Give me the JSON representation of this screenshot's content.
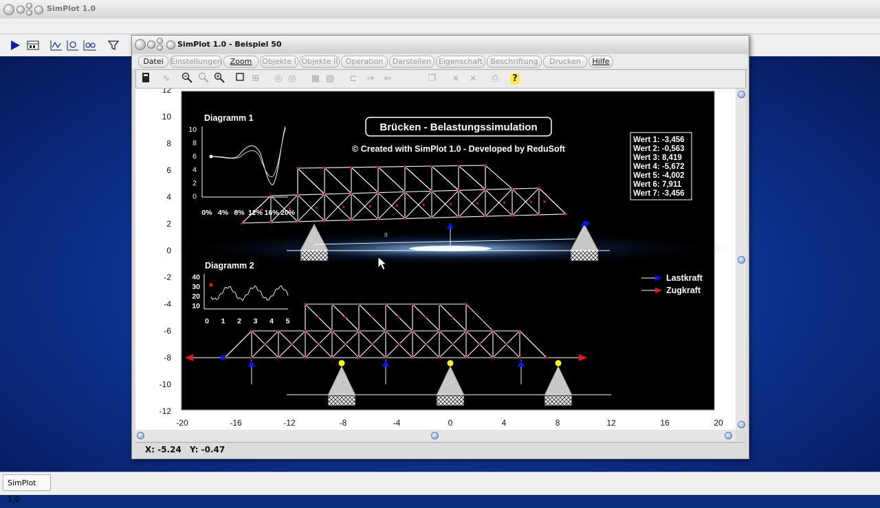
{
  "app": {
    "title": "SimPlot 1.0"
  },
  "taskbar": {
    "item": "SimPlot 1.0"
  },
  "outer_toolbar": {
    "icons": [
      "run-icon",
      "table-icon",
      "line-plot-icon",
      "function-plot-icon",
      "dataset-plot-icon",
      "filter-icon"
    ]
  },
  "window": {
    "title": "SimPlot 1.0 - Beispiel 50"
  },
  "menu": [
    {
      "label": "Datei",
      "enabled": true
    },
    {
      "label": "Einstellungen",
      "enabled": false
    },
    {
      "label": "Zoom",
      "enabled": true
    },
    {
      "label": "Objekte I",
      "enabled": false
    },
    {
      "label": "Objekte II",
      "enabled": false
    },
    {
      "label": "Operation",
      "enabled": false
    },
    {
      "label": "Darstellen",
      "enabled": false
    },
    {
      "label": "Eigenschaft",
      "enabled": false
    },
    {
      "label": "Beschriftung",
      "enabled": false
    },
    {
      "label": "Drucken",
      "enabled": false
    },
    {
      "label": "Hilfe",
      "enabled": true
    }
  ],
  "plot": {
    "title": "Brücken - Belastungssimulation",
    "subtitle": "© Created with SimPlot 1.0 - Developed by ReduSoft",
    "x_ticks": [
      "-20",
      "-16",
      "-12",
      "-8",
      "-4",
      "0",
      "4",
      "8",
      "12",
      "16",
      "20"
    ],
    "y_ticks": [
      "12",
      "10",
      "8",
      "6",
      "4",
      "2",
      "0",
      "-2",
      "-4",
      "-6",
      "-8",
      "-10",
      "-12"
    ],
    "values_box": [
      "Wert 1: -3,456",
      "Wert 2: -0,563",
      "Wert 3: 8,419",
      "Wert 4: -5,672",
      "Wert 5: -4,002",
      "Wert 6: 7,911",
      "Wert 7: -3,456"
    ],
    "legend": [
      {
        "label": "Lastkraft",
        "color": "#0018ff"
      },
      {
        "label": "Zugkraft",
        "color": "#e81818"
      }
    ],
    "diagram1": {
      "title": "Diagramm 1",
      "y_ticks": [
        "10",
        "8",
        "6",
        "4",
        "2",
        "0"
      ],
      "x_ticks": [
        "0%",
        "4%",
        "8%",
        "12%",
        "16%",
        "20%"
      ]
    },
    "diagram2": {
      "title": "Diagramm 2",
      "y_ticks": [
        "40",
        "30",
        "20",
        "10"
      ],
      "x_ticks": [
        "0",
        "1",
        "2",
        "3",
        "4",
        "5"
      ]
    },
    "support_label": "II"
  },
  "status": {
    "x": "X: -5.24",
    "y": "Y: -0.47"
  },
  "colors": {
    "desktop": "#0c2f8a",
    "plot_bg": "#000000",
    "truss": "#ffffff",
    "node": "#d01818",
    "load": "#0018ff",
    "accent": "#ffff00"
  }
}
